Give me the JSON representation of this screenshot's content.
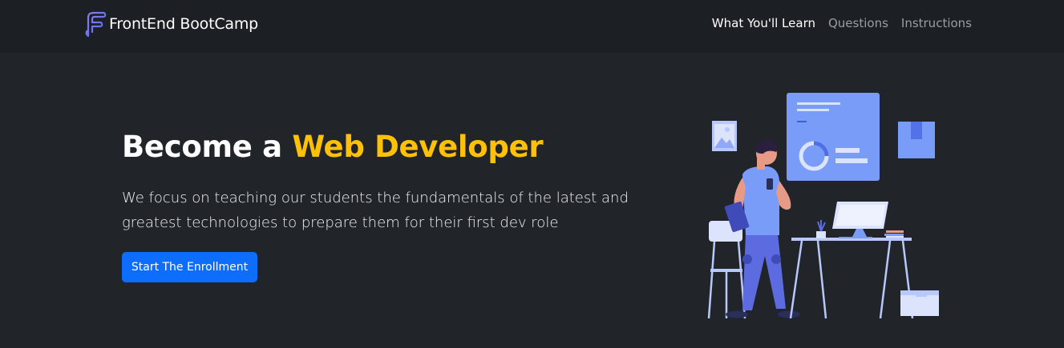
{
  "brand": {
    "name": "FrontEnd BootCamp",
    "logo_icon": "brand-logo-icon"
  },
  "nav": {
    "items": [
      {
        "label": "What You'll Learn",
        "active": true
      },
      {
        "label": "Questions",
        "active": false
      },
      {
        "label": "Instructions",
        "active": false
      }
    ]
  },
  "hero": {
    "title_prefix": "Become a ",
    "title_highlight": "Web Developer",
    "lead": "We focus on teaching our students the fundamentals of the latest and greatest technologies to prepare them for their first dev role",
    "cta_label": "Start The Enrollment",
    "illustration_icon": "developer-at-desk-illustration"
  },
  "colors": {
    "background": "#212529",
    "navbar": "#1c1f23",
    "accent": "#ffc107",
    "primary": "#0d6efd",
    "illustration": "#7a9cf9"
  }
}
